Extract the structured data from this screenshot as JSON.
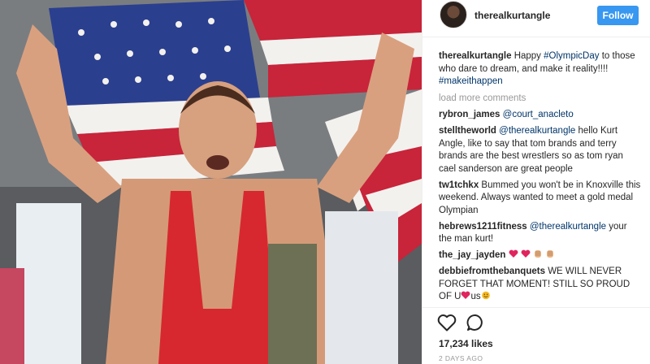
{
  "post": {
    "image_description_icon": "photo",
    "author": "therealkurtangle",
    "follow_label": "Follow",
    "caption_user": "therealkurtangle",
    "caption_parts": [
      "Happy ",
      "#OlympicDay",
      " to those who dare to dream, and make it reality!!!! ",
      "#makeithappen"
    ],
    "load_more": "load more comments",
    "comments": [
      {
        "user": "rybron_james",
        "parts": [
          {
            "t": "@court_anacleto",
            "tag": true
          }
        ]
      },
      {
        "user": "stelltheworld",
        "parts": [
          {
            "t": "@therealkurtangle",
            "tag": true
          },
          {
            "t": " hello Kurt Angle, like to say that tom brands and terry brands are the best wrestlers so as tom ryan cael sanderson are great people",
            "tag": false
          }
        ]
      },
      {
        "user": "tw1tchkx",
        "parts": [
          {
            "t": "Bummed you won't be in Knoxville this weekend. Always wanted to meet a gold medal Olympian",
            "tag": false
          }
        ]
      },
      {
        "user": "hebrews1211fitness",
        "parts": [
          {
            "t": "@therealkurtangle",
            "tag": true
          },
          {
            "t": " your the man kurt!",
            "tag": false
          }
        ]
      },
      {
        "user": "the_jay_jayden",
        "parts": [],
        "emojis": [
          "heart",
          "heart",
          "clap",
          "clap"
        ]
      },
      {
        "user": "debbiefromthebanquets",
        "parts": [
          {
            "t": "WE WILL NEVER FORGET THAT MOMENT! STILL SO PROUD OF U",
            "tag": false
          },
          {
            "t": "us",
            "tag": false
          }
        ],
        "inline_emojis": [
          "heart",
          "smile"
        ]
      }
    ],
    "likes": "17,234 likes",
    "time": "2 DAYS AGO"
  },
  "colors": {
    "follow_blue": "#3897f0",
    "tag_blue": "#003569",
    "muted": "#999999",
    "heart_red": "#ed4956"
  },
  "icons": {
    "like": "heart-outline-icon",
    "comment": "speech-bubble-icon"
  }
}
